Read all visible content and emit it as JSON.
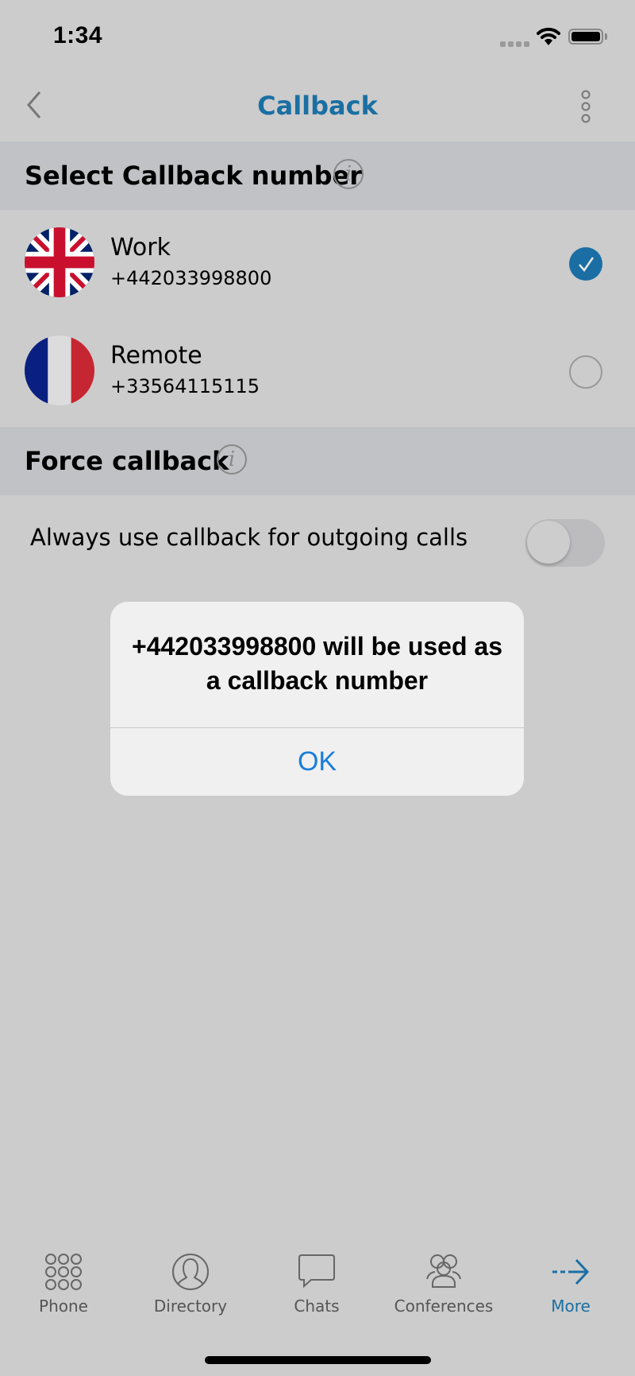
{
  "status_bar": {
    "time": "1:34"
  },
  "nav": {
    "title": "Callback",
    "back_icon": "chevron-left-icon",
    "menu_icon": "kebab-menu-icon"
  },
  "sections": {
    "select_number": {
      "title": "Select Callback number",
      "info_glyph": "i"
    },
    "force_callback": {
      "title": "Force callback",
      "info_glyph": "i"
    }
  },
  "numbers": [
    {
      "label": "Work",
      "number": "+442033998800",
      "flag": "uk-flag-icon",
      "selected": true,
      "check_glyph": "✓"
    },
    {
      "label": "Remote",
      "number": "+33564115115",
      "flag": "france-flag-icon",
      "selected": false
    }
  ],
  "force_toggle": {
    "label": "Always use callback for outgoing calls",
    "on": false
  },
  "dialog": {
    "message": "+442033998800 will be used as a callback number",
    "ok_label": "OK"
  },
  "tabs": [
    {
      "label": "Phone",
      "icon": "keypad-icon",
      "active": false
    },
    {
      "label": "Directory",
      "icon": "contact-icon",
      "active": false
    },
    {
      "label": "Chats",
      "icon": "chat-bubble-icon",
      "active": false
    },
    {
      "label": "Conferences",
      "icon": "group-icon",
      "active": false
    },
    {
      "label": "More",
      "icon": "dashed-arrow-right-icon",
      "active": true
    }
  ],
  "colors": {
    "accent": "#1a6fa3",
    "dialog_button": "#1a7ddb",
    "background": "#cccccc",
    "section_header": "#c1c2c6"
  }
}
